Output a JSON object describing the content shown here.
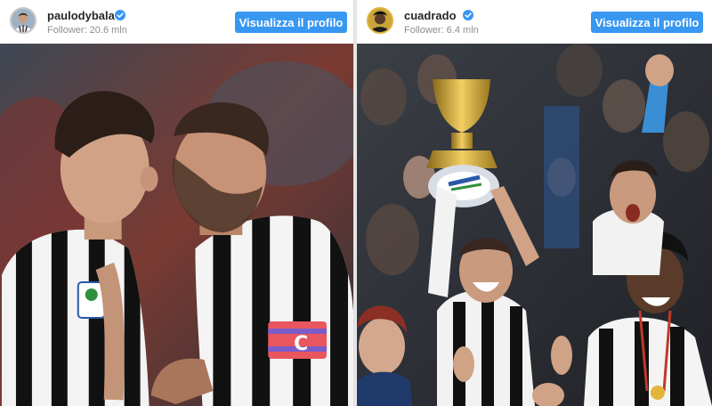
{
  "posts": [
    {
      "username": "paulodybala",
      "verified": true,
      "followers": "Follower: 20.6 mln",
      "button_label": "Visualizza il profilo",
      "photo_icon": "dybala-marchisio-photo"
    },
    {
      "username": "cuadrado",
      "verified": true,
      "followers": "Follower: 6.4 mln",
      "button_label": "Visualizza il profilo",
      "photo_icon": "trophy-celebration-photo"
    }
  ],
  "colors": {
    "button": "#3897f0",
    "verified": "#3897f0",
    "username": "#262626",
    "muted": "#8e8e8e"
  }
}
